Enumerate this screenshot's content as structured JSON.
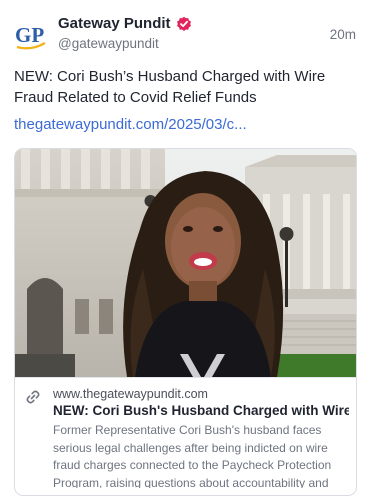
{
  "post": {
    "avatar_text": "GP",
    "author": "Gateway Pundit",
    "handle": "@gatewaypundit",
    "time": "20m",
    "text": "NEW: Cori Bush’s Husband Charged with Wire Fraud Related to Covid Relief Funds",
    "link": "thegatewaypundit.com/2025/03/c..."
  },
  "card": {
    "domain": "www.thegatewaypundit.com",
    "title": "NEW: Cori Bush's Husband Charged with Wire ...",
    "description": "Former Representative Cori Bush's husband faces serious legal challenges after being indicted on wire fraud charges connected to the Paycheck Protection Program, raising questions about accountability and p..."
  },
  "colors": {
    "link": "#3b6bd6",
    "verified": "#e0245e",
    "avatar_blue": "#2d5fa8",
    "avatar_gold": "#f2b21b"
  },
  "icons": [
    "verified-badge-icon",
    "link-icon"
  ]
}
